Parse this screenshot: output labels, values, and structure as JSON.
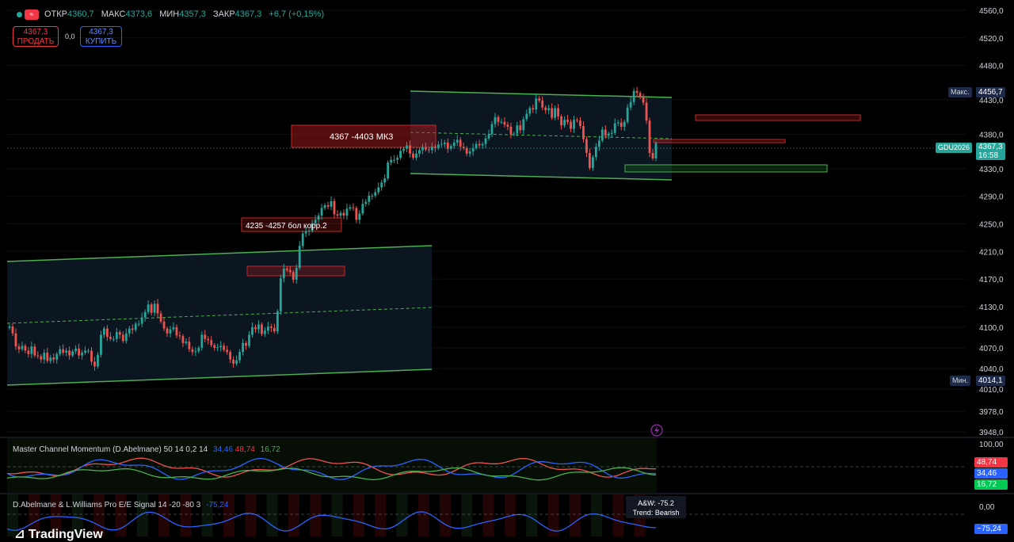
{
  "header": {
    "open_label": "ОТКР",
    "open": "4360,7",
    "high_label": "МАКС",
    "high": "4373,6",
    "low_label": "МИН",
    "low": "4357,3",
    "close_label": "ЗАКР",
    "close": "4367,3",
    "change": "+6,7 (+0,15%)"
  },
  "trade": {
    "sell_price": "4367,3",
    "sell_label": "ПРОДАТЬ",
    "spread": "0,0",
    "buy_price": "4367,3",
    "buy_label": "КУПИТЬ"
  },
  "price_axis": {
    "ticks": [
      "4560,0",
      "4520,0",
      "4480,0",
      "4430,0",
      "4380,0",
      "4330,0",
      "4290,0",
      "4250,0",
      "4210,0",
      "4170,0",
      "4130,0",
      "4100,0",
      "4070,0",
      "4040,0",
      "4010,0",
      "3978,0",
      "3948,0"
    ],
    "max_label": "Макс.",
    "max_value": "4456,7",
    "min_label": "Мин.",
    "min_value": "4014,1",
    "symbol": "GDU2026",
    "last_price": "4367,3",
    "countdown": "16:58"
  },
  "annotations": {
    "mk3": "4367 -4403 МК3",
    "corr2": "4235 -4257 бол корр.2"
  },
  "indicator1": {
    "title": "Master Channel Momentum (D.Abelmane) 50 14 0,2 14",
    "v_blue": "34,46",
    "v_red": "48,74",
    "v_green": "16,72",
    "axis_top": "100,00",
    "tag_red": "48,74",
    "tag_blue": "34,46",
    "tag_green": "16,72"
  },
  "indicator2": {
    "title": "D.Abelmane & L.Williams Pro E/E Signal 14 -20 -80 3",
    "value": "-75,24",
    "axis_top": "0,00",
    "tag_value": "−75,24",
    "box_line1": "A&W: -75.2",
    "box_line2": "Trend: Bearish"
  },
  "brand": "TradingView",
  "colors": {
    "up": "#26a69a",
    "down": "#ef5350",
    "channel": "#4caf50",
    "zone_red": "#b71c1c",
    "bg": "#000000"
  },
  "chart_data": {
    "type": "candlestick",
    "symbol": "GDU2026",
    "ylim": [
      3940,
      4575
    ],
    "x_index_range": [
      0,
      204
    ],
    "closes": [
      4101,
      4091,
      4072,
      4068,
      4073,
      4066,
      4061,
      4072,
      4059,
      4058,
      4053,
      4063,
      4051,
      4056,
      4053,
      4061,
      4068,
      4063,
      4066,
      4059,
      4065,
      4069,
      4059,
      4063,
      4066,
      4066,
      4050,
      4043,
      4060,
      4089,
      4098,
      4086,
      4083,
      4083,
      4093,
      4089,
      4080,
      4091,
      4098,
      4096,
      4105,
      4105,
      4114,
      4122,
      4133,
      4121,
      4134,
      4120,
      4108,
      4098,
      4091,
      4097,
      4100,
      4088,
      4087,
      4077,
      4079,
      4068,
      4064,
      4065,
      4070,
      4089,
      4083,
      4081,
      4074,
      4070,
      4071,
      4073,
      4067,
      4064,
      4053,
      4047,
      4052,
      4064,
      4077,
      4073,
      4089,
      4100,
      4097,
      4104,
      4090,
      4095,
      4101,
      4099,
      4094,
      4123,
      4171,
      4185,
      4183,
      4180,
      4169,
      4186,
      4218,
      4236,
      4239,
      4240,
      4251,
      4256,
      4262,
      4273,
      4277,
      4275,
      4283,
      4264,
      4262,
      4266,
      4262,
      4272,
      4274,
      4273,
      4256,
      4265,
      4279,
      4282,
      4291,
      4291,
      4296,
      4303,
      4310,
      4316,
      4339,
      4343,
      4343,
      4346,
      4356,
      4359,
      4364,
      4352,
      4346,
      4352,
      4357,
      4361,
      4358,
      4357,
      4362,
      4360,
      4365,
      4366,
      4368,
      4359,
      4363,
      4368,
      4372,
      4362,
      4360,
      4352,
      4355,
      4360,
      4366,
      4364,
      4366,
      4374,
      4380,
      4395,
      4405,
      4398,
      4398,
      4394,
      4391,
      4380,
      4381,
      4393,
      4386,
      4402,
      4410,
      4418,
      4416,
      4432,
      4429,
      4419,
      4415,
      4418,
      4404,
      4418,
      4406,
      4393,
      4401,
      4398,
      4388,
      4401,
      4400,
      4392,
      4373,
      4353,
      4331,
      4347,
      4362,
      4371,
      4387,
      4378,
      4381,
      4382,
      4396,
      4397,
      4391,
      4398,
      4419,
      4427,
      4443,
      4440,
      4434,
      4426,
      4400,
      4353,
      4345,
      4367
    ],
    "channels": [
      {
        "name": "lower",
        "upper": [
          [
            0,
            4187
          ],
          [
            132,
            4225
          ]
        ],
        "lower": [
          [
            0,
            4002
          ],
          [
            132,
            4037
          ]
        ]
      },
      {
        "name": "upper",
        "upper": [
          [
            126,
            4463
          ],
          [
            208,
            4457
          ]
        ],
        "lower": [
          [
            126,
            4331
          ],
          [
            208,
            4319
          ]
        ]
      }
    ],
    "zones": [
      {
        "label": "4367 -4403 МК3",
        "color": "red"
      },
      {
        "label": "4235 -4257 бол корр.2",
        "color": "red"
      },
      {
        "color": "red"
      },
      {
        "color": "red"
      },
      {
        "color": "green"
      }
    ]
  }
}
